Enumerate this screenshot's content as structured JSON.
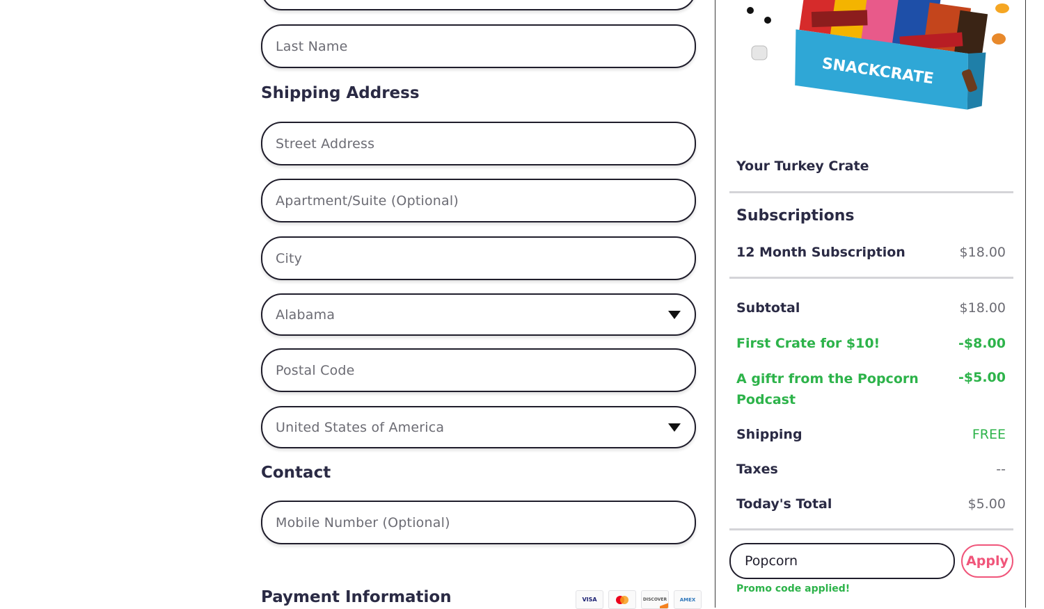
{
  "form": {
    "last_name_placeholder": "Last Name",
    "shipping_title": "Shipping Address",
    "street_placeholder": "Street Address",
    "apartment_placeholder": "Apartment/Suite (Optional)",
    "city_placeholder": "City",
    "state_selected": "Alabama",
    "postal_placeholder": "Postal Code",
    "country_selected": "United States of America",
    "contact_title": "Contact",
    "mobile_placeholder": "Mobile Number (Optional)",
    "payment_title": "Payment Information",
    "card_icons": [
      "visa-icon",
      "mastercard-icon",
      "discover-icon",
      "amex-icon"
    ],
    "card_labels": [
      "VISA",
      "",
      "DISCOVER",
      "AMEX"
    ]
  },
  "summary": {
    "crate_title": "Your Turkey Crate",
    "hero_brand": "SNACKCRATE",
    "subscriptions_title": "Subscriptions",
    "subscription_item": {
      "label": "12 Month Subscription",
      "price": "$18.00"
    },
    "subtotal": {
      "label": "Subtotal",
      "value": "$18.00"
    },
    "discount_first": {
      "label": "First Crate for $10!",
      "value": "-$8.00"
    },
    "discount_gift": {
      "label_line1": "A giftr from the Popcorn",
      "label_line2": "Podcast",
      "value": "-$5.00"
    },
    "shipping": {
      "label": "Shipping",
      "value": "FREE"
    },
    "taxes": {
      "label": "Taxes",
      "value": "--"
    },
    "total": {
      "label": "Today's Total",
      "value": "$5.00"
    },
    "promo": {
      "value": "Popcorn",
      "apply_label": "Apply",
      "message": "Promo code applied!"
    }
  },
  "colors": {
    "accent_green": "#2db34a",
    "apply_pink": "#f0557a",
    "text_dark": "#2a2a44"
  }
}
